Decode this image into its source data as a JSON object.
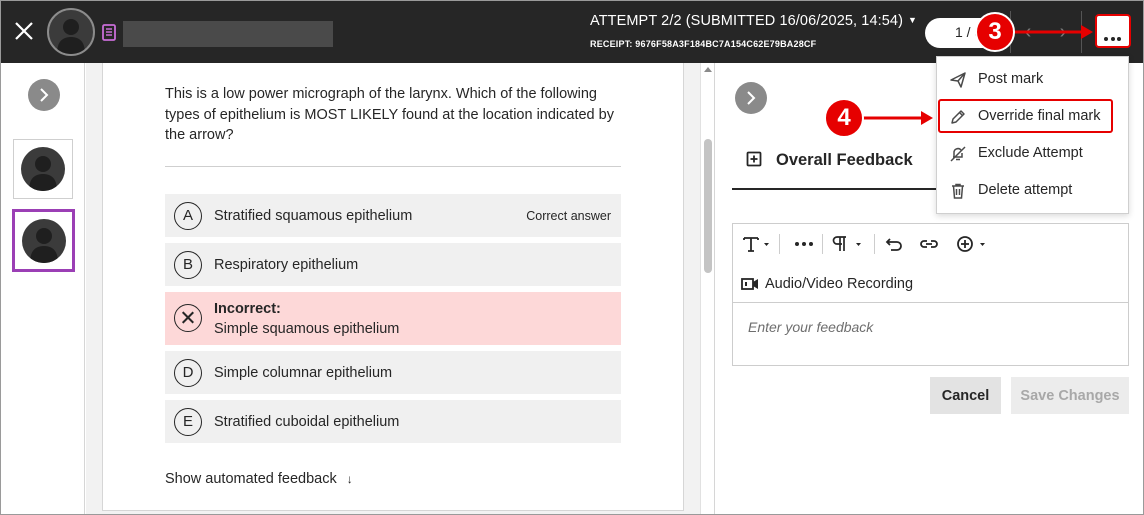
{
  "topbar": {
    "attempt_title": "ATTEMPT 2/2 (SUBMITTED 16/06/2025, 14:54)",
    "receipt": "RECEIPT: 9676F58A3F184BC7A154C62E79BA28CF",
    "pager": "1 / 5",
    "icons": [
      "close-icon",
      "avatar",
      "book-icon",
      "chevron-down-icon",
      "chevron-left-icon",
      "chevron-right-icon",
      "more-icon"
    ]
  },
  "question": {
    "text": "This is a low power micrograph of the larynx. Which of the following types of epithelium is MOST LIKELY found at the location indicated by the arrow?",
    "options": [
      {
        "letter": "A",
        "text": "Stratified squamous epithelium",
        "tag": "Correct answer"
      },
      {
        "letter": "B",
        "text": "Respiratory epithelium"
      },
      {
        "status": "Incorrect:",
        "text": "Simple squamous epithelium"
      },
      {
        "letter": "D",
        "text": "Simple columnar epithelium"
      },
      {
        "letter": "E",
        "text": "Stratified cuboidal epithelium"
      }
    ],
    "show_feedback": "Show automated feedback",
    "show_feedback_arrow": "↓"
  },
  "feedback": {
    "tab_label": "Overall Feedback",
    "av_recording": "Audio/Video Recording",
    "placeholder": "Enter your feedback",
    "cancel": "Cancel",
    "save": "Save Changes"
  },
  "menu": {
    "items": [
      {
        "label": "Post mark",
        "icon": "send-icon"
      },
      {
        "label": "Override final mark",
        "icon": "pencil-icon"
      },
      {
        "label": "Exclude Attempt",
        "icon": "bell-off-icon"
      },
      {
        "label": "Delete attempt",
        "icon": "trash-icon"
      }
    ]
  },
  "callouts": {
    "step3": "3",
    "step4": "4"
  },
  "colors": {
    "topbar": "#262626",
    "callout": "#e60000",
    "selected_thumb_border": "#9b3fb5",
    "incorrect_bg": "#fdd8d8",
    "book_icon": "#c86dd7"
  }
}
